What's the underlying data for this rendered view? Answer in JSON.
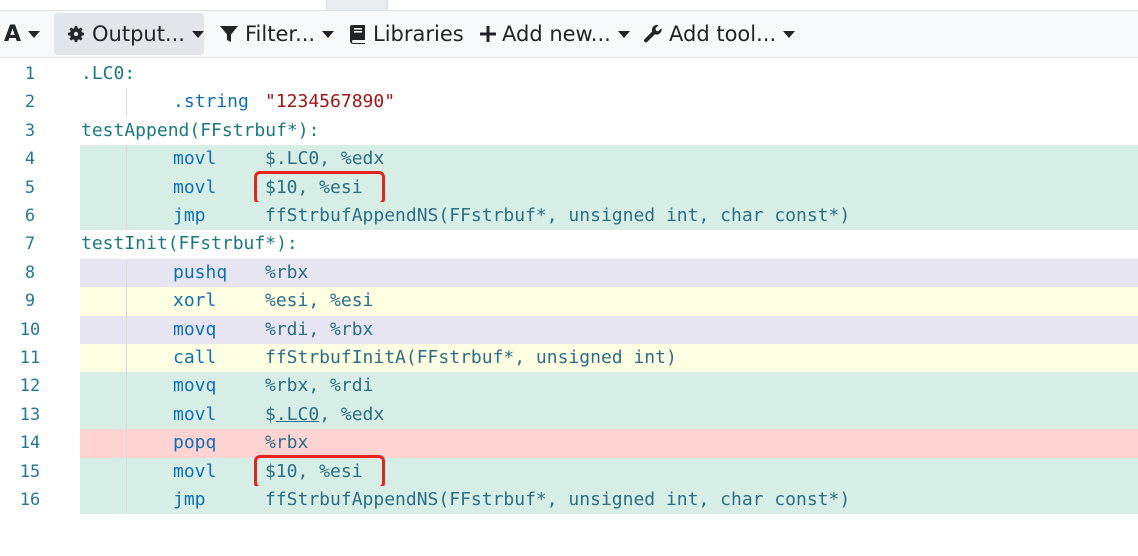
{
  "toolbar": {
    "font_label": "A",
    "output_label": "Output...",
    "filter_label": "Filter...",
    "libraries_label": "Libraries",
    "add_new_label": "Add new...",
    "add_tool_label": "Add tool..."
  },
  "colors": {
    "green": "#d6eee6",
    "lavender": "#e6e5f1",
    "yellow": "#fefee2",
    "red": "#fed4d2",
    "highlight_box": "#e8231e"
  },
  "lines": [
    {
      "n": "1",
      "bg": "none",
      "label": ".LC0:"
    },
    {
      "n": "2",
      "bg": "none",
      "instr": ".string",
      "string": "\"1234567890\""
    },
    {
      "n": "3",
      "bg": "none",
      "label": "testAppend(FFstrbuf*):"
    },
    {
      "n": "4",
      "bg": "green",
      "instr": "movl",
      "operands": "$.LC0, %edx"
    },
    {
      "n": "5",
      "bg": "green",
      "instr": "movl",
      "operands": "$10, %esi",
      "boxed": true
    },
    {
      "n": "6",
      "bg": "green",
      "instr": "jmp",
      "operands": "ffStrbufAppendNS(FFstrbuf*, unsigned int, char const*)"
    },
    {
      "n": "7",
      "bg": "none",
      "label": "testInit(FFstrbuf*):"
    },
    {
      "n": "8",
      "bg": "lavender",
      "instr": "pushq",
      "operands": "%rbx"
    },
    {
      "n": "9",
      "bg": "yellow",
      "instr": "xorl",
      "operands": "%esi, %esi"
    },
    {
      "n": "10",
      "bg": "lavender",
      "instr": "movq",
      "operands": "%rdi, %rbx"
    },
    {
      "n": "11",
      "bg": "yellow",
      "instr": "call",
      "operands": "ffStrbufInitA(FFstrbuf*, unsigned int)"
    },
    {
      "n": "12",
      "bg": "green",
      "instr": "movq",
      "operands": "%rbx, %rdi"
    },
    {
      "n": "13",
      "bg": "green",
      "instr": "movl",
      "operands_pre": "$",
      "operands_link": ".LC0",
      "operands_post": ", %edx"
    },
    {
      "n": "14",
      "bg": "red",
      "instr": "popq",
      "operands": "%rbx"
    },
    {
      "n": "15",
      "bg": "green",
      "instr": "movl",
      "operands": "$10, %esi",
      "boxed": true
    },
    {
      "n": "16",
      "bg": "green",
      "instr": "jmp",
      "operands": "ffStrbufAppendNS(FFstrbuf*, unsigned int, char const*)"
    }
  ]
}
